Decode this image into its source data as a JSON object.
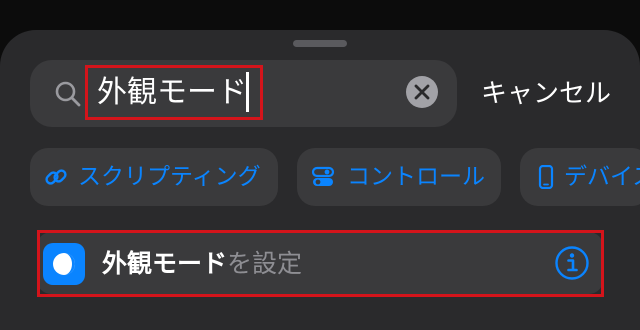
{
  "search": {
    "query": "外観モード",
    "cancel_label": "キャンセル"
  },
  "chips": [
    {
      "label": "スクリプティング",
      "icon": "link-icon"
    },
    {
      "label": "コントロール",
      "icon": "toggle-icon"
    },
    {
      "label": "デバイス",
      "icon": "phone-icon"
    }
  ],
  "result": {
    "title_bold": "外観モード",
    "title_rest": "を設定",
    "icon": "appearance-icon",
    "info_icon": "info-icon"
  },
  "colors": {
    "accent": "#0a84ff",
    "highlight": "#d4141b",
    "sheet": "#2a2a2c",
    "field": "#3a3a3c"
  }
}
